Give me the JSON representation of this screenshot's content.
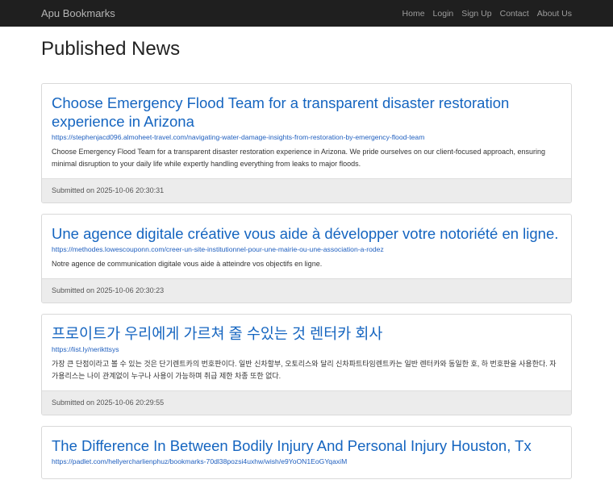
{
  "navbar": {
    "brand": "Apu Bookmarks",
    "links": [
      "Home",
      "Login",
      "Sign Up",
      "Contact",
      "About Us"
    ]
  },
  "page_title": "Published News",
  "posts": [
    {
      "title": "Choose Emergency Flood Team for a transparent disaster restoration experience in Arizona",
      "url": "https://stephenjacd096.almoheet-travel.com/navigating-water-damage-insights-from-restoration-by-emergency-flood-team",
      "description": "Choose Emergency Flood Team for a transparent disaster restoration experience in Arizona. We pride ourselves on our client-focused approach, ensuring minimal disruption to your daily life while expertly handling everything from leaks to major floods.",
      "submitted": "Submitted on 2025-10-06 20:30:31"
    },
    {
      "title": "Une agence digitale créative vous aide à développer votre notoriété en ligne.",
      "url": "https://methodes.lowescouponn.com/creer-un-site-institutionnel-pour-une-mairie-ou-une-association-a-rodez",
      "description": "Notre agence de communication digitale vous aide à atteindre vos objectifs en ligne.",
      "submitted": "Submitted on 2025-10-06 20:30:23"
    },
    {
      "title": "프로이트가 우리에게 가르쳐 줄 수있는 것 렌터카 회사",
      "url": "https://list.ly/neriktts​ys",
      "description": "가장 큰 단점이라고 볼 수 있는 것은 단기렌트카의 번호판이다. 일반 신차할부, 오토리스와 달리 신차파트타임렌트카는 일반 렌터카와 동일한 호, 하 번호판을 사용한다. 자가용리스는 나이 관계없이 누구나 사용이 가능하며 취급 제한 차종 또한 없다.",
      "submitted": "Submitted on 2025-10-06 20:29:55"
    },
    {
      "title": "The Difference In Between Bodily Injury And Personal Injury Houston, Tx",
      "url": "https://padlet.com/hellyercharlienphuz/bookmarks-70dl38pozsi4uxhw/wish/e9YoON1EoGYqaxiM",
      "description": "",
      "submitted": ""
    }
  ]
}
